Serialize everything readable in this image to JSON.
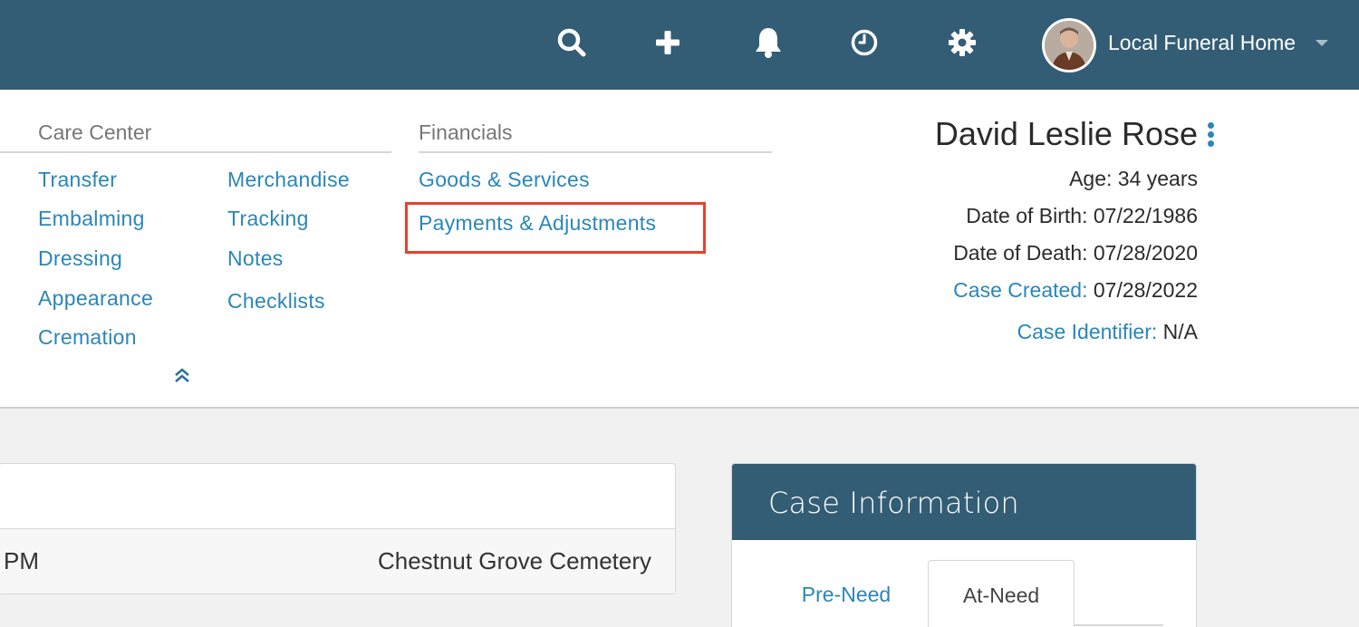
{
  "topbar": {
    "icons": [
      "search-icon",
      "plus-icon",
      "bell-icon",
      "clock-icon",
      "gear-icon"
    ],
    "account_name": "Local Funeral Home",
    "bg_color": "#335d75"
  },
  "care_center": {
    "title": "Care Center",
    "col1": [
      "Transfer",
      "Embalming",
      "Dressing",
      "Appearance",
      "Cremation"
    ],
    "col2": [
      "Merchandise",
      "Tracking",
      "Notes",
      "Checklists"
    ]
  },
  "financials": {
    "title": "Financials",
    "items": [
      "Goods & Services",
      "Payments & Adjustments"
    ]
  },
  "patient": {
    "name": "David Leslie Rose",
    "age": "Age: 34 years",
    "dob": "Date of Birth: 07/22/1986",
    "dod": "Date of Death: 07/28/2020",
    "case_created_label": "Case Created:",
    "case_created_value": "07/28/2022",
    "case_identifier_label": "Case Identifier:",
    "case_identifier_value": "N/A"
  },
  "event_row": {
    "time": "PM",
    "place": "Chestnut Grove Cemetery"
  },
  "case_info": {
    "title": "Case Information",
    "tabs": [
      "Pre-Need",
      "At-Need"
    ],
    "active_tab": "At-Need"
  },
  "colors": {
    "link": "#2a86b8",
    "highlight": "#e8402f"
  }
}
